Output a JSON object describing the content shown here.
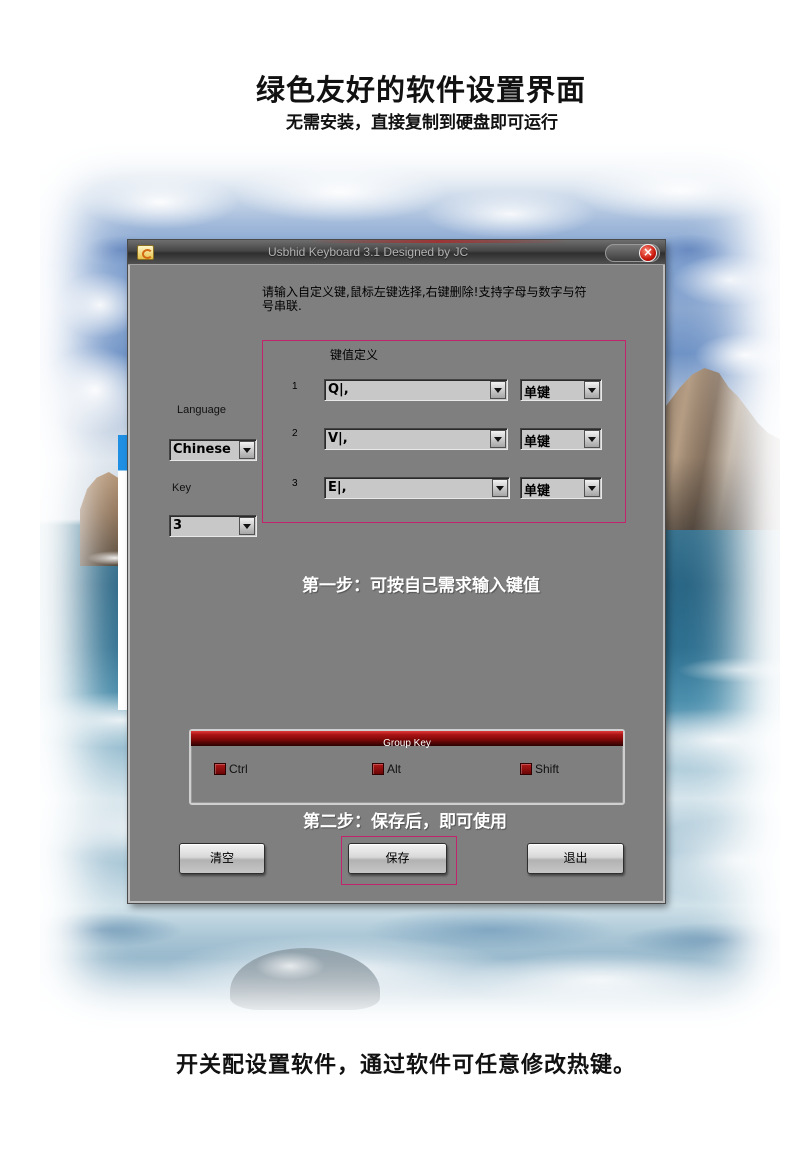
{
  "promo": {
    "title": "绿色友好的软件设置界面",
    "subtitle": "无需安装，直接复制到硬盘即可运行",
    "step1": "第一步：可按自己需求输入键值",
    "step2": "第二步：保存后，即可使用",
    "footer": "开关配设置软件，通过软件可任意修改热键。"
  },
  "window": {
    "title": "Usbhid Keyboard 3.1 Designed by JC",
    "close_symbol": "×",
    "icons": {
      "app": "app-logo-icon",
      "close": "close-icon",
      "dropdown": "chevron-down-icon"
    },
    "instructions": "请输入自定义键,鼠标左键选择,右键删除!支持字母与数字与符号串联.",
    "language": {
      "label": "Language",
      "value": "Chinese"
    },
    "key_count": {
      "label": "Key",
      "value": "3"
    },
    "key_definition": {
      "heading": "键值定义",
      "rows": [
        {
          "index": "1",
          "value": "Q|,",
          "mode": "单键"
        },
        {
          "index": "2",
          "value": "V|,",
          "mode": "单键"
        },
        {
          "index": "3",
          "value": "E|,",
          "mode": "单键"
        }
      ]
    },
    "group_key": {
      "title": "Group Key",
      "options": [
        {
          "label": "Ctrl",
          "checked": false
        },
        {
          "label": "Alt",
          "checked": false
        },
        {
          "label": "Shift",
          "checked": false
        }
      ]
    },
    "buttons": {
      "clear": "清空",
      "save": "保存",
      "exit": "退出"
    }
  },
  "colors": {
    "highlight_border": "#c4236e",
    "window_body": "#7f7f7f",
    "group_header": "#8b0a0a",
    "step_text": "#ffffff"
  }
}
